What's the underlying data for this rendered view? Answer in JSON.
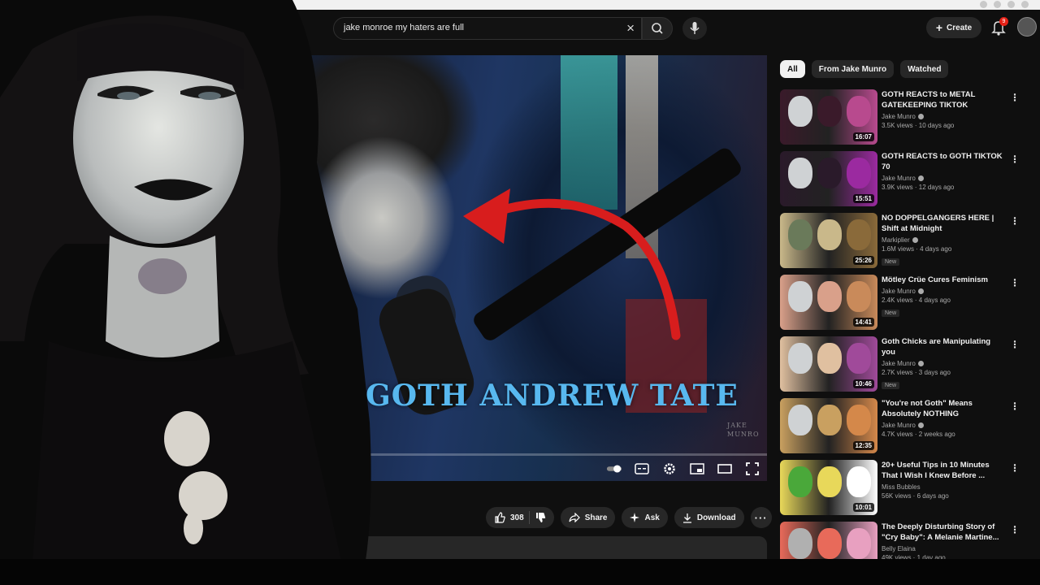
{
  "search": {
    "query": "jake monroe my haters are full"
  },
  "masthead": {
    "create_label": "Create",
    "notification_count": "9"
  },
  "video": {
    "overlay_title": "GOTH ANDREW TATE",
    "watermark_line1": "JAKE",
    "watermark_line2": "MUNRO"
  },
  "actions": {
    "like_count": "308",
    "share_label": "Share",
    "ask_label": "Ask",
    "download_label": "Download"
  },
  "chips": [
    "All",
    "From Jake Munro",
    "Watched"
  ],
  "recommendations": [
    {
      "title": "GOTH REACTS to METAL GATEKEEPING TIKTOK",
      "channel": "Jake Munro",
      "verified": true,
      "stats": "3.5K views · 10 days ago",
      "duration": "16:07",
      "new": false,
      "colors": [
        "#cfd2d4",
        "#3a1a2a",
        "#b84a8e"
      ]
    },
    {
      "title": "GOTH REACTS to GOTH TIKTOK 70",
      "channel": "Jake Munro",
      "verified": true,
      "stats": "3.9K views · 12 days ago",
      "duration": "15:51",
      "new": false,
      "colors": [
        "#cfd2d4",
        "#2a1a2a",
        "#9b2aa0"
      ]
    },
    {
      "title": "NO DOPPELGANGERS HERE | Shift at Midnight",
      "channel": "Markiplier",
      "verified": true,
      "stats": "1.6M views · 4 days ago",
      "duration": "25:26",
      "new": true,
      "colors": [
        "#6a7a5a",
        "#c9b88a",
        "#8a6a3a"
      ]
    },
    {
      "title": "Mötley Crüe Cures Feminism",
      "channel": "Jake Munro",
      "verified": true,
      "stats": "2.4K views · 4 days ago",
      "duration": "14:41",
      "new": true,
      "colors": [
        "#cfd2d4",
        "#d9a08a",
        "#c98a5a"
      ]
    },
    {
      "title": "Goth Chicks are Manipulating you",
      "channel": "Jake Munro",
      "verified": true,
      "stats": "2.7K views · 3 days ago",
      "duration": "10:46",
      "new": true,
      "colors": [
        "#cfd2d4",
        "#e0c0a0",
        "#a04a9a"
      ]
    },
    {
      "title": "\"You're not Goth\" Means Absolutely NOTHING",
      "channel": "Jake Munro",
      "verified": true,
      "stats": "4.7K views · 2 weeks ago",
      "duration": "12:35",
      "new": false,
      "colors": [
        "#cfd2d4",
        "#c9a060",
        "#d4884a"
      ]
    },
    {
      "title": "20+ Useful Tips in 10 Minutes That I Wish I Knew Before ...",
      "channel": "Miss Bubbles",
      "verified": false,
      "stats": "56K views · 6 days ago",
      "duration": "10:01",
      "new": false,
      "colors": [
        "#4aa83a",
        "#e8d85a",
        "#ffffff"
      ]
    },
    {
      "title": "The Deeply Disturbing Story of \"Cry Baby\": A Melanie Martine...",
      "channel": "Belly Elaina",
      "verified": false,
      "stats": "49K views · 1 day ago",
      "duration": "",
      "new": false,
      "colors": [
        "#b0b0b0",
        "#e86a5a",
        "#e8a0c0"
      ]
    }
  ]
}
